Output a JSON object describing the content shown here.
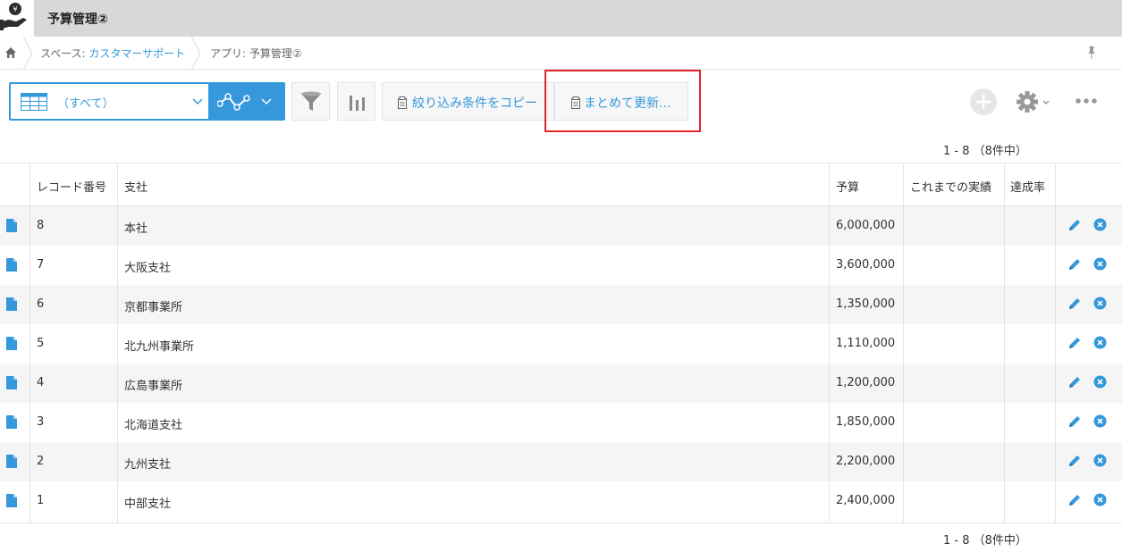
{
  "app": {
    "title": "予算管理②"
  },
  "breadcrumb": {
    "space_prefix": "スペース: ",
    "space_name": "カスタマーサポート",
    "app_label": "アプリ: 予算管理②"
  },
  "toolbar": {
    "view_label": "（すべて）",
    "copy_filter_label": "絞り込み条件をコピー",
    "bulk_update_label": "まとめて更新..."
  },
  "pager": {
    "top": "1 - 8 （8件中）",
    "bottom": "1 - 8 （8件中）"
  },
  "table": {
    "headers": [
      "レコード番号",
      "支社",
      "予算",
      "これまでの実績",
      "達成率"
    ],
    "rows": [
      {
        "id": "8",
        "branch": "本社",
        "budget": "6,000,000"
      },
      {
        "id": "7",
        "branch": "大阪支社",
        "budget": "3,600,000"
      },
      {
        "id": "6",
        "branch": "京都事業所",
        "budget": "1,350,000"
      },
      {
        "id": "5",
        "branch": "北九州事業所",
        "budget": "1,110,000"
      },
      {
        "id": "4",
        "branch": "広島事業所",
        "budget": "1,200,000"
      },
      {
        "id": "3",
        "branch": "北海道支社",
        "budget": "1,850,000"
      },
      {
        "id": "2",
        "branch": "九州支社",
        "budget": "2,200,000"
      },
      {
        "id": "1",
        "branch": "中部支社",
        "budget": "2,400,000"
      }
    ]
  },
  "colors": {
    "accent": "#3498db",
    "highlight": "#e0262b"
  },
  "icons": [
    "app-money-icon",
    "home-icon",
    "pin-icon",
    "table-view-icon",
    "graph-icon",
    "filter-icon",
    "bar-chart-icon",
    "copy-icon",
    "bulk-update-icon",
    "plus-icon",
    "gear-icon",
    "more-icon",
    "document-icon",
    "edit-icon",
    "delete-icon"
  ]
}
